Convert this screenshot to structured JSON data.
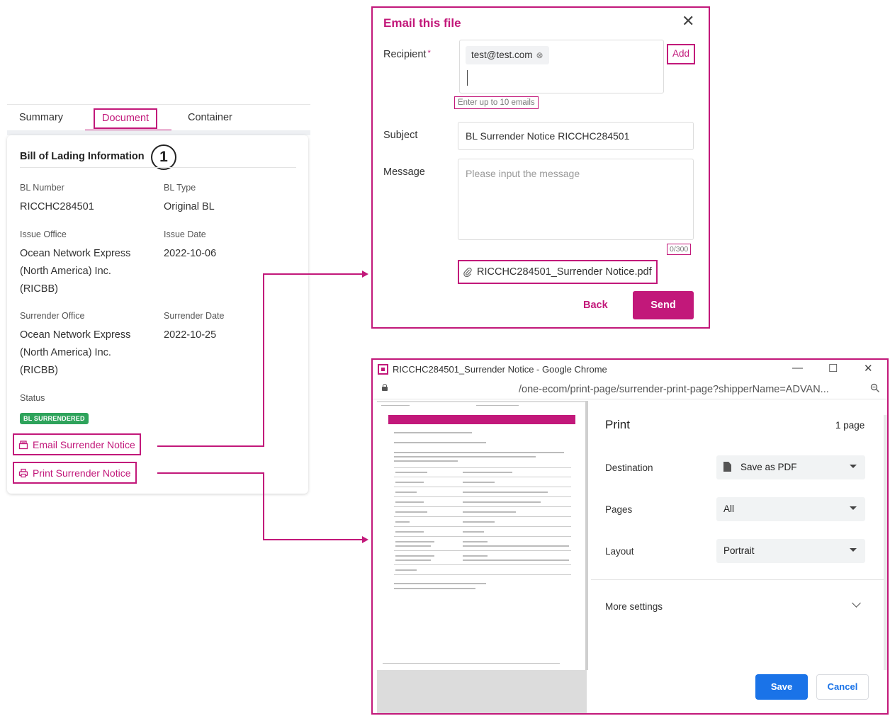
{
  "left_panel": {
    "tabs": [
      {
        "label": "Summary"
      },
      {
        "label": "Document"
      },
      {
        "label": "Container"
      }
    ],
    "card": {
      "title": "Bill of Lading Information",
      "step_number": "1",
      "fields": {
        "bl_number": {
          "label": "BL Number",
          "value": "RICCHC284501"
        },
        "bl_type": {
          "label": "BL Type",
          "value": "Original BL"
        },
        "issue_office": {
          "label": "Issue Office",
          "line1": "Ocean Network Express",
          "line2": "(North America) Inc.",
          "line3": "(RICBB)"
        },
        "issue_date": {
          "label": "Issue Date",
          "value": "2022-10-06"
        },
        "surrender_office": {
          "label": "Surrender Office",
          "line1": "Ocean Network Express",
          "line2": "(North America) Inc.",
          "line3": "(RICBB)"
        },
        "surrender_date": {
          "label": "Surrender Date",
          "value": "2022-10-25"
        },
        "status": {
          "label": "Status",
          "value": "BL SURRENDERED"
        }
      },
      "actions": {
        "email": "Email Surrender Notice",
        "print": "Print Surrender Notice"
      }
    }
  },
  "email_dialog": {
    "title": "Email this file",
    "recipient_label": "Recipient",
    "required_mark": "*",
    "recipient_chip": "test@test.com",
    "chip_remove_glyph": "⊗",
    "add_label": "Add",
    "hint": "Enter up to 10 emails",
    "subject_label": "Subject",
    "subject_value": "BL Surrender Notice RICCHC284501",
    "message_label": "Message",
    "message_placeholder": "Please input the message",
    "counter": "0/300",
    "attachment": "RICCHC284501_Surrender Notice.pdf",
    "back_label": "Back",
    "send_label": "Send",
    "close_glyph": "✕"
  },
  "chrome_window": {
    "title": "RICCHC284501_Surrender Notice - Google Chrome",
    "url": "/one-ecom/print-page/surrender-print-page?shipperName=ADVAN...",
    "minimize_glyph": "—",
    "maximize_glyph": "☐",
    "close_glyph": "✕",
    "print_panel": {
      "title": "Print",
      "page_count": "1 page",
      "destination_label": "Destination",
      "destination_value": "Save as PDF",
      "pages_label": "Pages",
      "pages_value": "All",
      "layout_label": "Layout",
      "layout_value": "Portrait",
      "more_settings_label": "More settings",
      "save_label": "Save",
      "cancel_label": "Cancel"
    }
  },
  "colors": {
    "accent": "#c2187a",
    "status_green": "#2ea35b",
    "chrome_blue": "#1a73e8"
  }
}
